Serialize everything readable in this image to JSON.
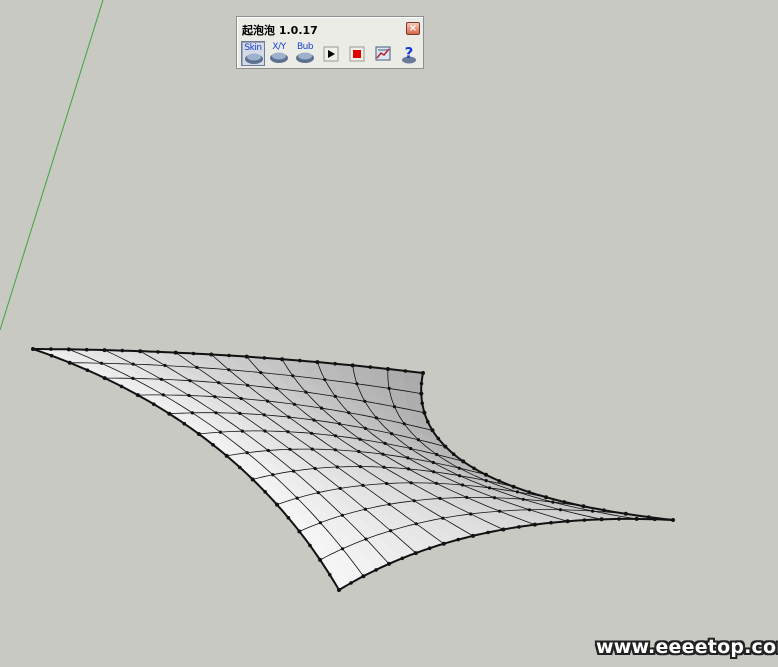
{
  "toolbar": {
    "title": "起泡泡 1.0.17",
    "close_glyph": "×",
    "buttons": [
      {
        "name": "skin",
        "label": "Skin",
        "icon": "skin-icon",
        "pressed": true
      },
      {
        "name": "xy",
        "label": "X/Y",
        "icon": "xy-icon",
        "pressed": false
      },
      {
        "name": "bub",
        "label": "Bub",
        "icon": "bub-icon",
        "pressed": false
      },
      {
        "name": "play",
        "label": "",
        "icon": "play-icon",
        "pressed": false
      },
      {
        "name": "stop",
        "label": "",
        "icon": "stop-icon",
        "pressed": false
      },
      {
        "name": "chart",
        "label": "",
        "icon": "chart-icon",
        "pressed": false
      },
      {
        "name": "help",
        "label": "",
        "icon": "help-icon",
        "pressed": false
      }
    ]
  },
  "viewport": {
    "background": "#c9c9c3",
    "green_axis_color": "#3aa63a",
    "surface": {
      "grid_u": 11,
      "grid_v": 11,
      "edge_color": "#111111"
    }
  },
  "watermark": {
    "text": "www.eeeetop.com"
  }
}
